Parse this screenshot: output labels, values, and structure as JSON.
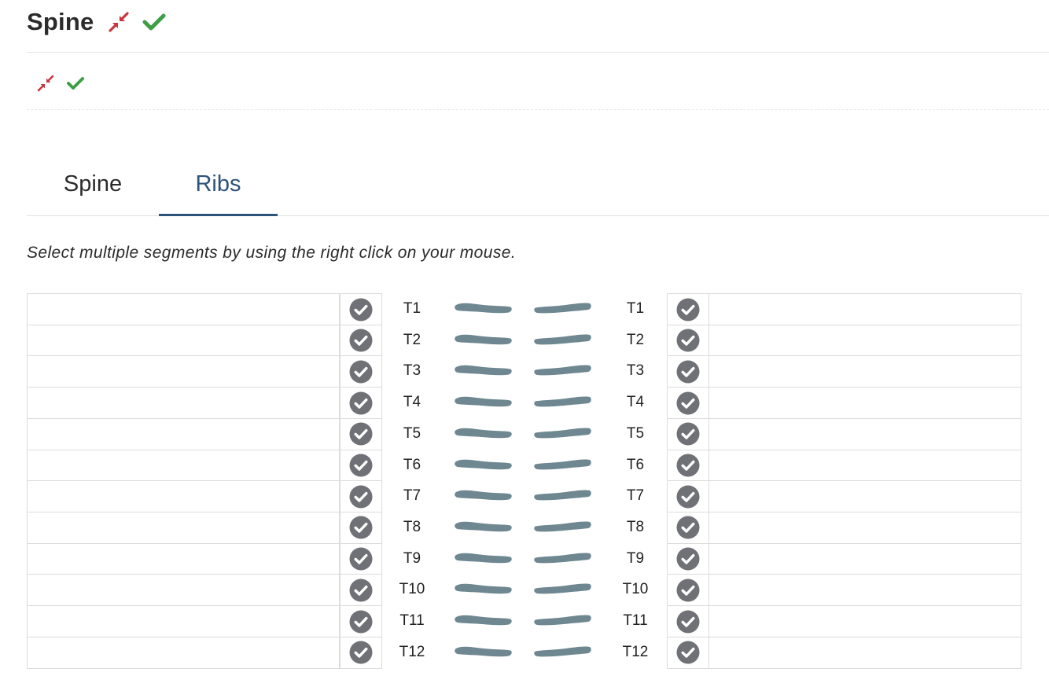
{
  "header": {
    "title": "Spine",
    "collapse_icon": "collapse-arrows-icon",
    "check_icon": "checkmark-icon",
    "collapse_color": "#c8363f",
    "check_color": "#3f9e45"
  },
  "sub_toolbar": {
    "collapse_icon": "collapse-arrows-icon",
    "check_icon": "checkmark-icon"
  },
  "tabs": [
    {
      "label": "Spine",
      "active": false
    },
    {
      "label": "Ribs",
      "active": true
    }
  ],
  "instruction": "Select multiple segments by using the right click on your mouse.",
  "colors": {
    "accent": "#2c5379",
    "rib": "#6e8791",
    "check_circle": "#6f7176"
  },
  "ribs": [
    {
      "left_label": "T1",
      "right_label": "T1"
    },
    {
      "left_label": "T2",
      "right_label": "T2"
    },
    {
      "left_label": "T3",
      "right_label": "T3"
    },
    {
      "left_label": "T4",
      "right_label": "T4"
    },
    {
      "left_label": "T5",
      "right_label": "T5"
    },
    {
      "left_label": "T6",
      "right_label": "T6"
    },
    {
      "left_label": "T7",
      "right_label": "T7"
    },
    {
      "left_label": "T8",
      "right_label": "T8"
    },
    {
      "left_label": "T9",
      "right_label": "T9"
    },
    {
      "left_label": "T10",
      "right_label": "T10"
    },
    {
      "left_label": "T11",
      "right_label": "T11"
    },
    {
      "left_label": "T12",
      "right_label": "T12"
    }
  ]
}
